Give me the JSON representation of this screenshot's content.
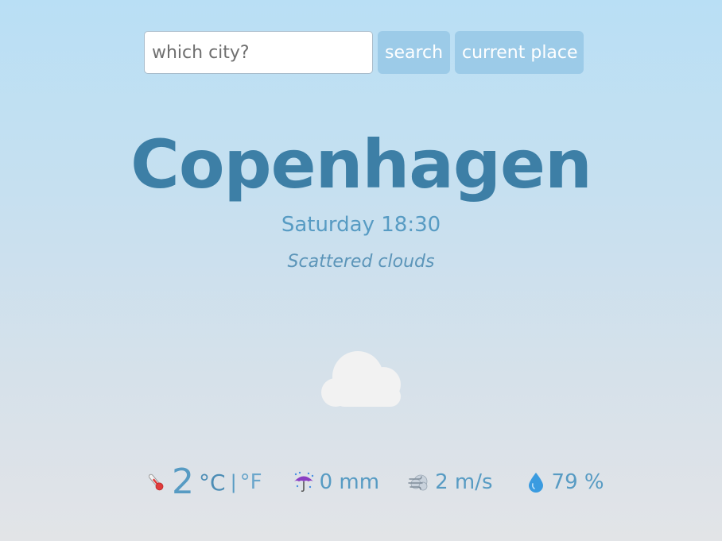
{
  "search": {
    "placeholder": "which city?",
    "value": "",
    "search_label": "search",
    "current_place_label": "current place"
  },
  "weather": {
    "city": "Copenhagen",
    "datetime": "Saturday 18:30",
    "description": "Scattered clouds",
    "icon": "cloud-icon"
  },
  "stats": {
    "temperature": "2",
    "unit_celsius": "°C",
    "unit_separator": "|",
    "unit_fahrenheit": "°F",
    "precipitation": "0 mm",
    "wind": "2 m/s",
    "humidity": "79 %"
  },
  "icons": {
    "temperature": "thermometer-icon",
    "precipitation": "umbrella-rain-icon",
    "wind": "wind-icon",
    "humidity": "droplet-icon"
  },
  "colors": {
    "city_text": "#3d7fa6",
    "accent_text": "#579bc3",
    "button_bg": "#9ccbe8",
    "button_text": "#ffffff"
  }
}
